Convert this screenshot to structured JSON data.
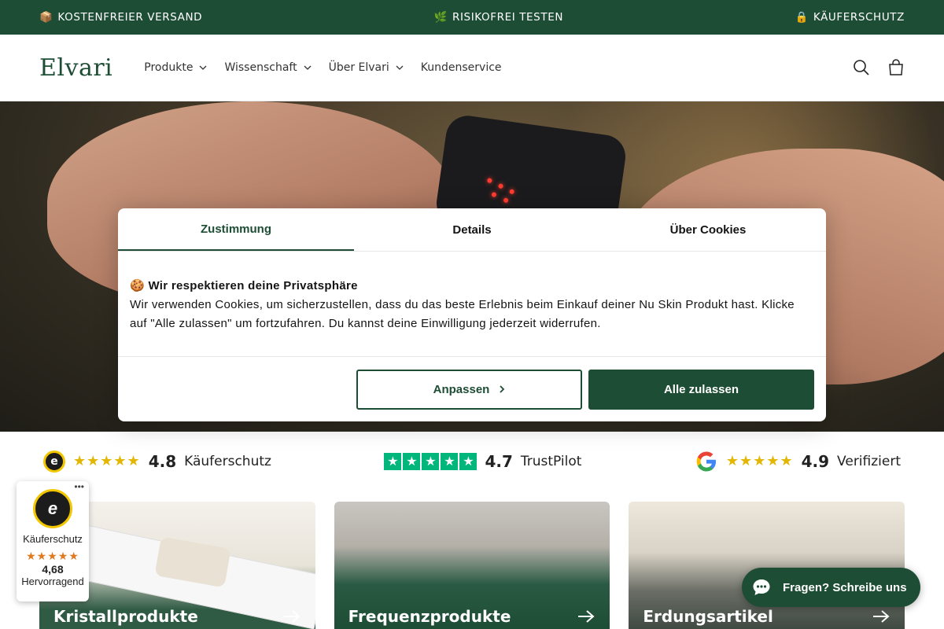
{
  "announcement": {
    "items": [
      {
        "icon": "package-icon",
        "emoji": "📦",
        "text": "KOSTENFREIER VERSAND"
      },
      {
        "icon": "leaf-icon",
        "emoji": "🌿",
        "text": "RISIKOFREI TESTEN"
      },
      {
        "icon": "lock-icon",
        "emoji": "🔒",
        "text": "KÄUFERSCHUTZ"
      }
    ]
  },
  "header": {
    "logo": "Elvari",
    "nav": [
      {
        "label": "Produkte",
        "has_dropdown": true
      },
      {
        "label": "Wissenschaft",
        "has_dropdown": true
      },
      {
        "label": "Über Elvari",
        "has_dropdown": true
      },
      {
        "label": "Kundenservice",
        "has_dropdown": false
      }
    ]
  },
  "cookie": {
    "tabs": [
      {
        "label": "Zustimmung",
        "active": true
      },
      {
        "label": "Details",
        "active": false
      },
      {
        "label": "Über Cookies",
        "active": false
      }
    ],
    "title": "🍪 Wir respektieren deine Privatsphäre",
    "text": "Wir verwenden Cookies, um sicherzustellen, dass du das beste Erlebnis beim Einkauf deiner Nu Skin Produkt hast. Klicke auf \"Alle zulassen\" um fortzufahren. Du kannst deine Einwilligung jederzeit widerrufen.",
    "customize_label": "Anpassen",
    "accept_label": "Alle zulassen"
  },
  "ratings": [
    {
      "source": "trusted-shops",
      "score": "4.8",
      "label": "Käuferschutz",
      "stars": 5
    },
    {
      "source": "trustpilot",
      "score": "4.7",
      "label": "TrustPilot",
      "stars": 5
    },
    {
      "source": "google",
      "score": "4.9",
      "label": "Verifiziert",
      "stars": 5
    }
  ],
  "cards": [
    {
      "label": "Kristallprodukte"
    },
    {
      "label": "Frequenzprodukte"
    },
    {
      "label": "Erdungsartikel"
    }
  ],
  "trusted_badge": {
    "seal_letter": "e",
    "label": "Käuferschutz",
    "score": "4,68",
    "rating_text": "Hervorragend",
    "stars": 5
  },
  "chat": {
    "label": "Fragen? Schreibe uns"
  },
  "colors": {
    "brand_green": "#1e4d35",
    "star_gold": "#e3b600",
    "trustpilot_green": "#00b67a"
  }
}
